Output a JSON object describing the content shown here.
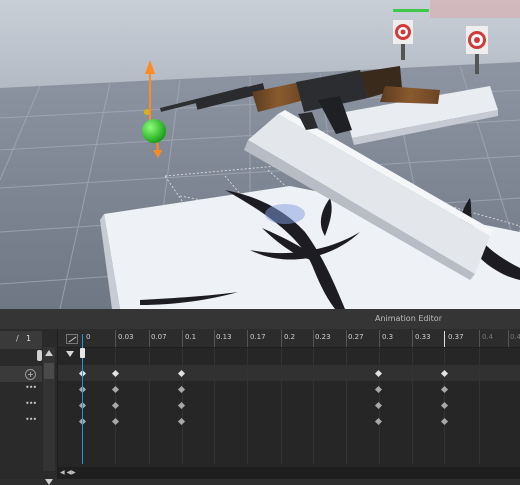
{
  "editor": {
    "title": "Animation Editor",
    "current_frame": "1",
    "frame_separator": "/",
    "ticks": [
      "0",
      "0.03",
      "0.07",
      "0.1",
      "0.13",
      "0.17",
      "0.2",
      "0.23",
      "0.27",
      "0.3",
      "0.33",
      "0.37",
      "0.4",
      "0.4"
    ],
    "row_menu": "•••",
    "add_symbol": "+",
    "hscroll_label": "◀ ◀▶"
  },
  "viewport": {
    "health_bar_color": "#3ec84a",
    "gizmo_colors": {
      "y_axis": "#ff8a1e",
      "center": "#35d535",
      "x_axis": "#f2c21a"
    }
  },
  "colors": {
    "playhead": "#1f9ad6",
    "keyframe_primary": "#e2e2e2",
    "keyframe_secondary": "#a8a8a8"
  }
}
